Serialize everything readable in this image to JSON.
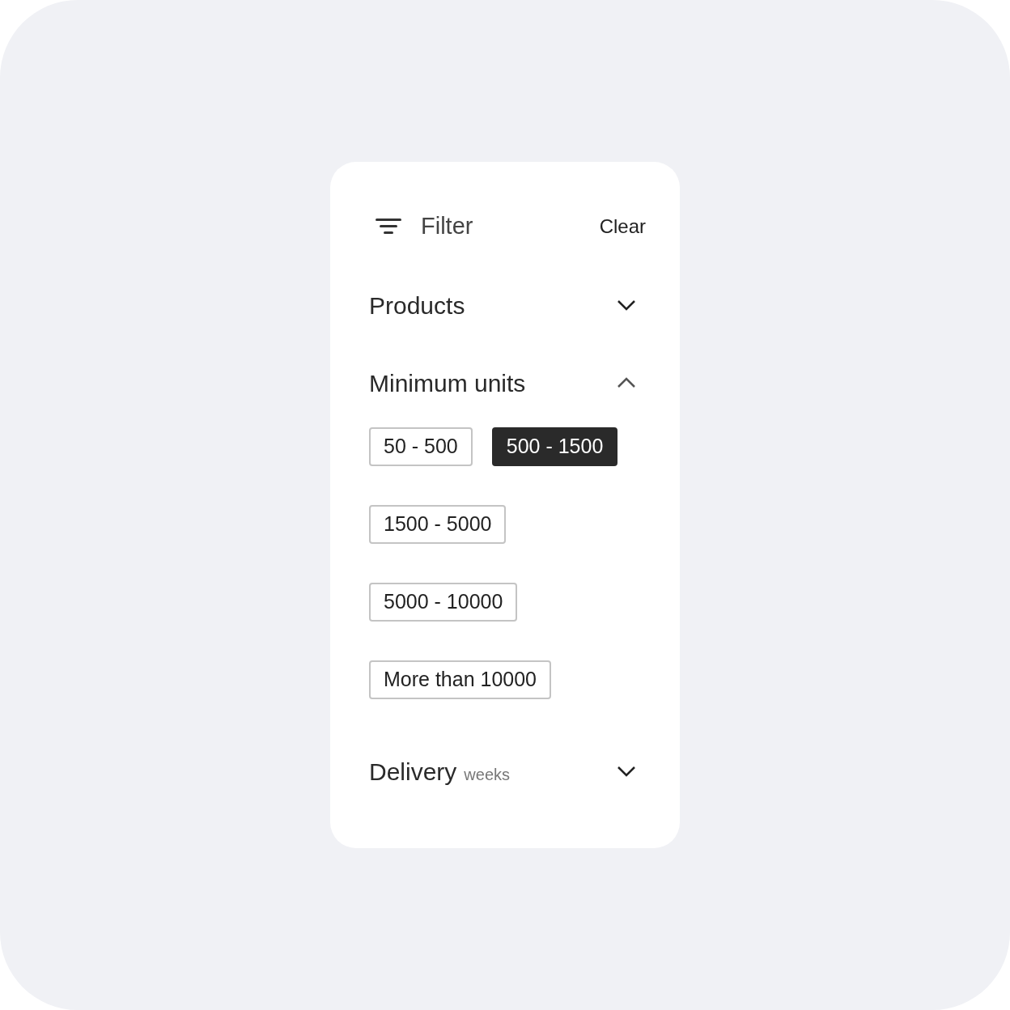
{
  "header": {
    "title": "Filter",
    "clear": "Clear"
  },
  "sections": [
    {
      "title": "Products",
      "expanded": false
    },
    {
      "title": "Minimum units",
      "expanded": true,
      "options": [
        {
          "label": "50 - 500",
          "selected": false
        },
        {
          "label": "500 - 1500",
          "selected": true
        },
        {
          "label": "1500 - 5000",
          "selected": false
        },
        {
          "label": "5000 - 10000",
          "selected": false
        },
        {
          "label": "More than 10000",
          "selected": false
        }
      ]
    },
    {
      "title": "Delivery",
      "subtitle": "weeks",
      "expanded": false
    }
  ]
}
